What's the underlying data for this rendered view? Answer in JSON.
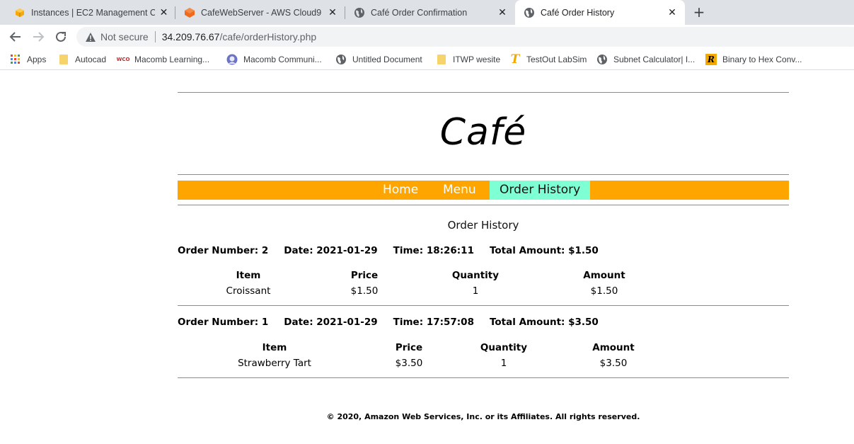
{
  "browser": {
    "tabs": [
      {
        "title": "Instances | EC2 Management Console",
        "icon": "aws-ec2-icon",
        "active": false
      },
      {
        "title": "CafeWebServer - AWS Cloud9",
        "icon": "aws-cloud9-icon",
        "active": false
      },
      {
        "title": "Café Order Confirmation",
        "icon": "globe-icon",
        "active": false
      },
      {
        "title": "Café Order History",
        "icon": "globe-icon",
        "active": true
      }
    ],
    "new_tab_label": "+",
    "close_glyph": "✕",
    "address": {
      "security_label": "Not secure",
      "host": "34.209.76.67",
      "path": "/cafe/orderHistory.php"
    },
    "bookmarks": [
      {
        "label": "Apps",
        "icon": "apps-grid-icon"
      },
      {
        "label": "Autocad",
        "icon": "folder-icon"
      },
      {
        "label": "Macomb Learning...",
        "icon": "wco-logo-icon",
        "icon_text": "WCO"
      },
      {
        "label": "Macomb Communi...",
        "icon": "macomb-logo-icon"
      },
      {
        "label": "Untitled Document",
        "icon": "globe-icon"
      },
      {
        "label": "ITWP wesite",
        "icon": "folder-icon"
      },
      {
        "label": "TestOut LabSim",
        "icon": "testout-logo-icon",
        "icon_text": "T"
      },
      {
        "label": "Subnet Calculator| I...",
        "icon": "globe-icon"
      },
      {
        "label": "Binary to Hex Conv...",
        "icon": "r-logo-icon",
        "icon_text": "R"
      }
    ]
  },
  "site": {
    "title": "Café",
    "nav": [
      {
        "label": "Home",
        "current": false
      },
      {
        "label": "Menu",
        "current": false
      },
      {
        "label": "Order History",
        "current": true
      }
    ],
    "accent_color": "#ffa500",
    "current_nav_color": "#7fffd4"
  },
  "order_history": {
    "heading": "Order History",
    "orders": [
      {
        "number": "Order Number: 2",
        "date": "Date: 2021-01-29",
        "time": "Time: 18:26:11",
        "total": "Total Amount: $1.50",
        "columns": [
          "Item",
          "Price",
          "Quantity",
          "Amount"
        ],
        "rows": [
          {
            "item": "Croissant",
            "price": "$1.50",
            "quantity": "1",
            "amount": "$1.50"
          }
        ]
      },
      {
        "number": "Order Number: 1",
        "date": "Date: 2021-01-29",
        "time": "Time: 17:57:08",
        "total": "Total Amount: $3.50",
        "columns": [
          "Item",
          "Price",
          "Quantity",
          "Amount"
        ],
        "rows": [
          {
            "item": "Strawberry Tart",
            "price": "$3.50",
            "quantity": "1",
            "amount": "$3.50"
          }
        ]
      }
    ]
  },
  "footer": "© 2020, Amazon Web Services, Inc. or its Affiliates. All rights reserved."
}
